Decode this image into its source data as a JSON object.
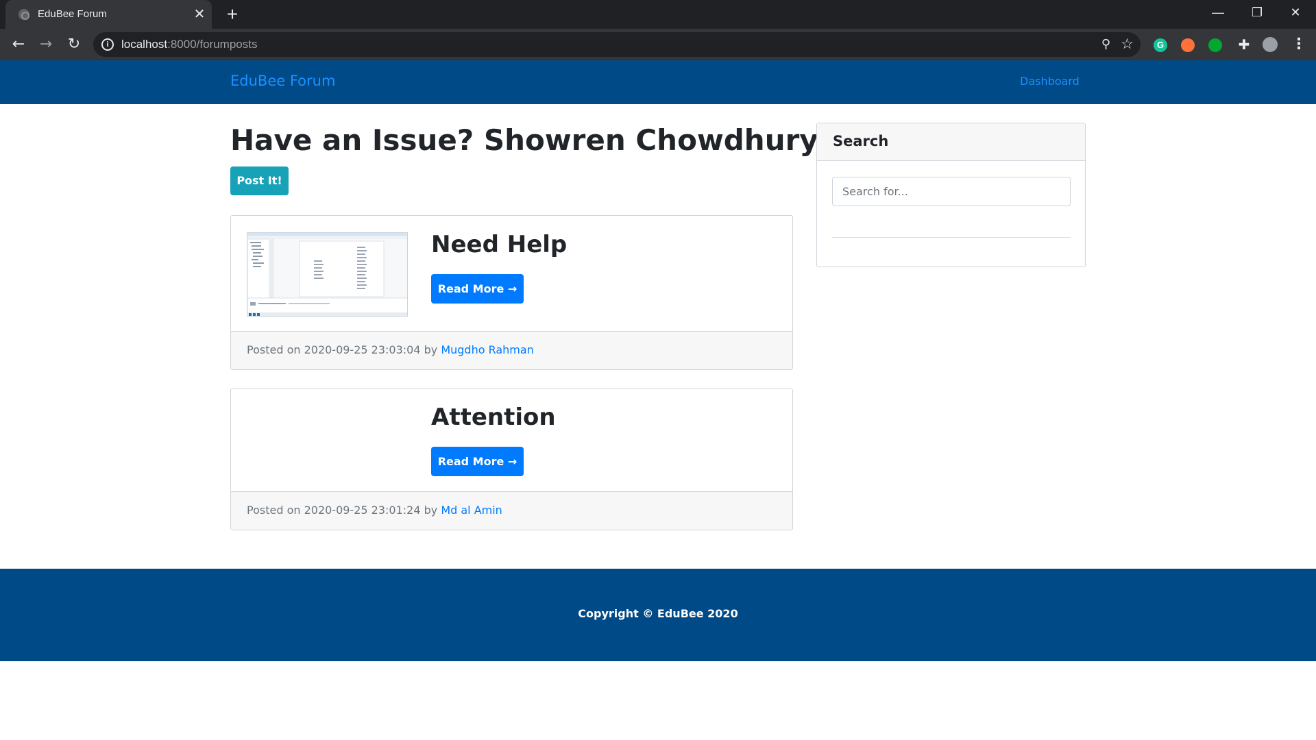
{
  "browser": {
    "tab_title": "EduBee Forum",
    "url_host": "localhost",
    "url_path": ":8000/forumposts",
    "extensions": [
      "grammarly-icon",
      "fox-extension-icon",
      "evernote-icon",
      "puzzle-icon",
      "profile-avatar"
    ],
    "grammarly_letter": "G"
  },
  "navbar": {
    "brand": "EduBee Forum",
    "dashboard": "Dashboard",
    "background": "#004a87",
    "link_color": "#1e90ff"
  },
  "main": {
    "heading": "Have an Issue? Showren Chowdhury",
    "post_button": "Post It!",
    "posts": [
      {
        "title": "Need Help",
        "read_more": "Read More →",
        "posted_prefix": "Posted on 2020-09-25 23:03:04 by",
        "author": "Mugdho Rahman",
        "has_thumbnail": true
      },
      {
        "title": "Attention",
        "read_more": "Read More →",
        "posted_prefix": "Posted on 2020-09-25 23:01:24 by",
        "author": "Md al Amin",
        "has_thumbnail": false
      }
    ]
  },
  "sidebar": {
    "search_title": "Search",
    "search_placeholder": "Search for..."
  },
  "footer": {
    "copyright": "Copyright © EduBee 2020"
  },
  "colors": {
    "primary": "#007bff",
    "info": "#17a2b8"
  }
}
